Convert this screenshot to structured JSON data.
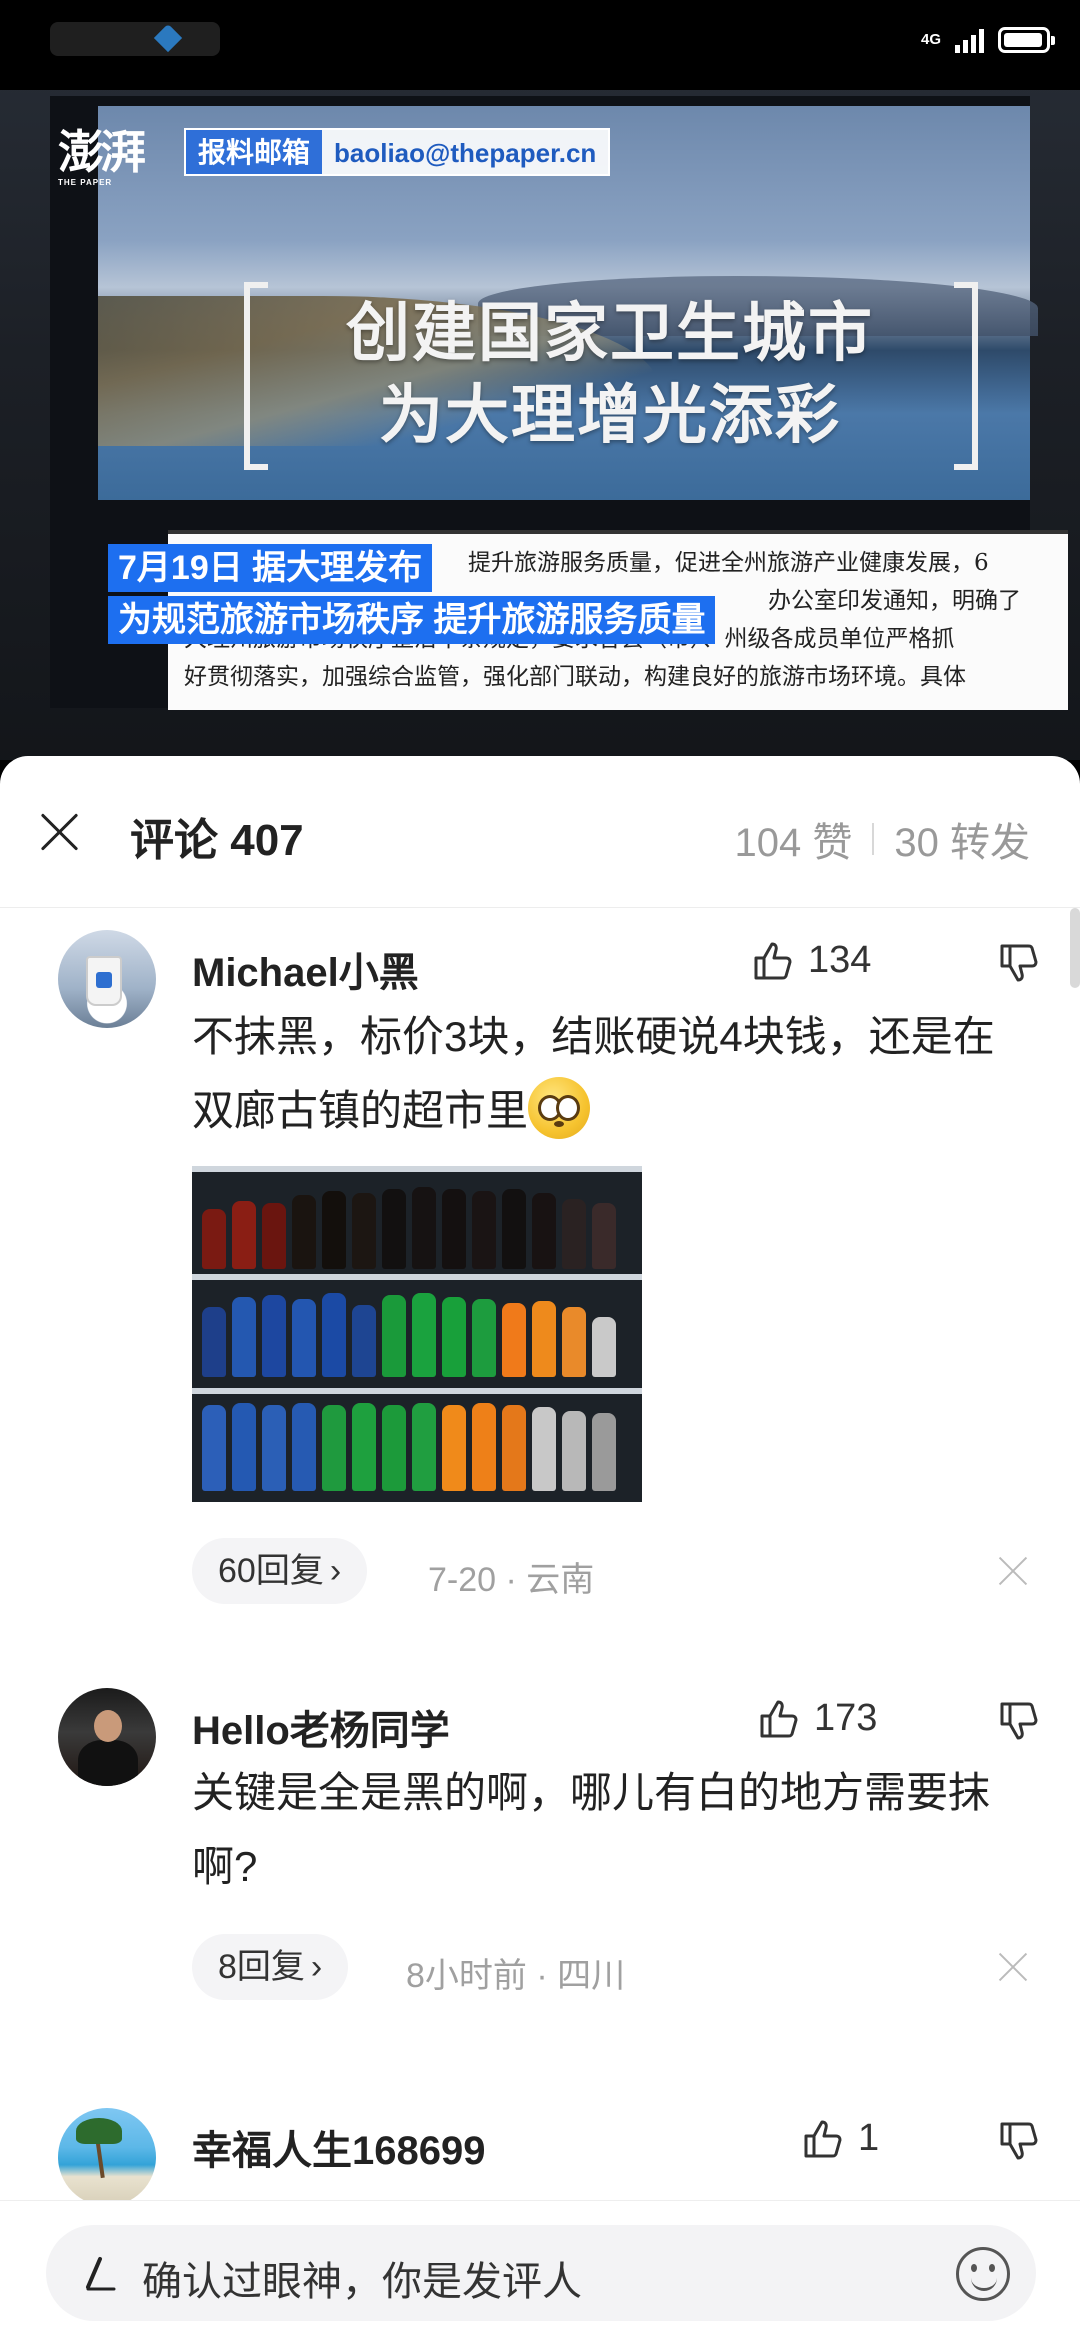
{
  "status_bar": {
    "network": "4G",
    "battery_level": 0.85
  },
  "video": {
    "logo_text": "澎湃",
    "logo_sub": "THE PAPER",
    "report_tag": "报料邮箱",
    "report_email": "baoliao@thepaper.cn",
    "headline_line1": "创建国家卫生城市",
    "headline_line2": "为大理增光添彩",
    "caption_line1": "7月19日 据大理发布",
    "caption_line2": "为规范旅游市场秩序 提升旅游服务质量",
    "doc_line1": "提升旅游服务质量，促进全州旅游产业健康发展，6",
    "doc_line2": "办公室印发通知，明确了",
    "doc_line3": "大理州旅游市场秩序整治十条规定，要求各县（市）、州级各成员单位严格抓",
    "doc_line4": "好贯彻落实，加强综合监管，强化部门联动，构建良好的旅游市场环境。具体"
  },
  "sheet": {
    "title": "评论 407",
    "likes": "104 赞",
    "shares": "30 转发"
  },
  "comments": [
    {
      "username": "Michael小黑",
      "likes": "134",
      "text": "不抹黑，标价3块，结账硬说4块钱，还是在双廊古镇的超市里",
      "replies": "60回复",
      "meta": "7-20 · 云南"
    },
    {
      "username": "Hello老杨同学",
      "likes": "173",
      "text": "关键是全是黑的啊，哪儿有白的地方需要抹啊?",
      "replies": "8回复",
      "meta": "8小时前 · 四川"
    },
    {
      "username": "幸福人生168699",
      "likes": "1"
    }
  ],
  "input": {
    "placeholder": "确认过眼神，你是发评人"
  },
  "colors": {
    "accent_blue": "#1d6ff0",
    "text_primary": "#222222",
    "text_secondary": "#a0a0a0"
  }
}
